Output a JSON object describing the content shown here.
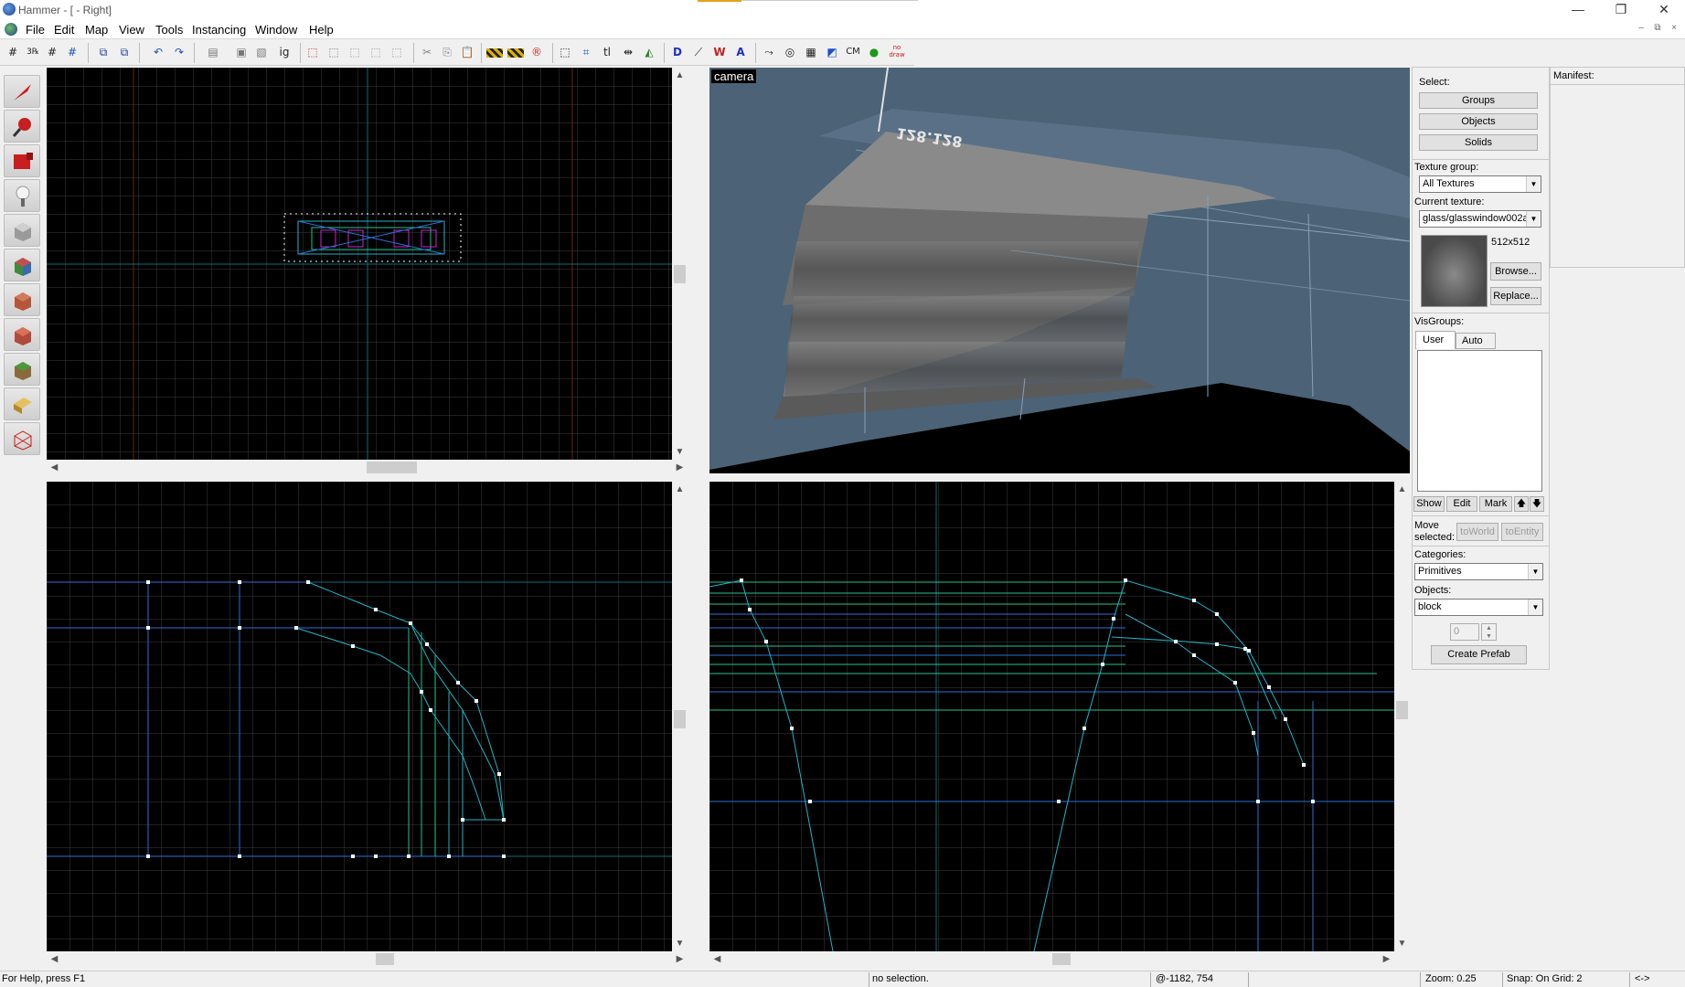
{
  "window": {
    "title": "Hammer - [ - Right]",
    "minimize": "—",
    "restore": "❐",
    "close": "✕"
  },
  "menu": {
    "items": [
      "File",
      "Edit",
      "Map",
      "View",
      "Tools",
      "Instancing",
      "Window",
      "Help"
    ]
  },
  "mdi": {
    "minimize": "–",
    "restore": "⧉",
    "close": "×"
  },
  "toolbar": {
    "buttons": [
      "grid",
      "grid-snap",
      "grid-small",
      "grid-large",
      "carve",
      "group",
      "undo",
      "redo",
      "hollow",
      "paste-special",
      "copy-special",
      "ig",
      "toggle-groups",
      "ungroup",
      "hide",
      "unhide",
      "hide-all",
      "cut",
      "copy",
      "paste",
      "texture-lock",
      "texture-lock-scale",
      "radius",
      "select-box",
      "select-size",
      "tl",
      "flip-h",
      "flip-v",
      "display-wireframe",
      "display-flat",
      "display-textured",
      "display-shaded",
      "display-logical",
      "sphere",
      "grid-toggle",
      "vis-groups",
      "CM",
      "cordon",
      "nodraw"
    ],
    "labels": {
      "ig": "ig",
      "tl": "tl",
      "cm": "CM",
      "nodraw": "no draw"
    }
  },
  "tools": [
    "selection-tool",
    "magnify-tool",
    "camera-tool",
    "entity-tool",
    "block-tool",
    "texture-tool",
    "apply-texture-tool",
    "decal-tool",
    "overlay-tool",
    "clipping-tool",
    "vertex-tool"
  ],
  "viewports": {
    "camera": {
      "label": "camera",
      "brush_label": "128.128"
    }
  },
  "select_panel": {
    "heading": "Select:",
    "groups": "Groups",
    "objects": "Objects",
    "solids": "Solids"
  },
  "texture_panel": {
    "group_label": "Texture group:",
    "group_value": "All Textures",
    "current_label": "Current texture:",
    "current_value": "glass/glasswindow002a",
    "size": "512x512",
    "browse": "Browse...",
    "replace": "Replace..."
  },
  "visgroups": {
    "heading": "VisGroups:",
    "tab_user": "User",
    "tab_auto": "Auto",
    "show": "Show",
    "edit": "Edit",
    "mark": "Mark",
    "up": "🡅",
    "down": "🡇"
  },
  "move_selected": {
    "label_line1": "Move",
    "label_line2": "selected:",
    "to_world": "toWorld",
    "to_entity": "toEntity"
  },
  "prefab": {
    "categories_label": "Categories:",
    "categories_value": "Primitives",
    "objects_label": "Objects:",
    "objects_value": "block",
    "count": "0",
    "create": "Create Prefab"
  },
  "manifest": {
    "heading": "Manifest:"
  },
  "status": {
    "help": "For Help, press F1",
    "selection": "no selection.",
    "coords": "@-1182, 754",
    "zoom": "Zoom: 0.25",
    "snap": "Snap: On Grid: 2",
    "end": "<->"
  },
  "colors": {
    "grid": "#4d4d4d",
    "axis_red": "#7a2a16",
    "axis_cyan": "#0f6a72",
    "brush_cyan": "#1fb5c7",
    "brush_teal": "#22c48f",
    "brush_blue": "#2b6fd6",
    "handle": "#ffffff",
    "camera_bg": "#4c6277"
  }
}
